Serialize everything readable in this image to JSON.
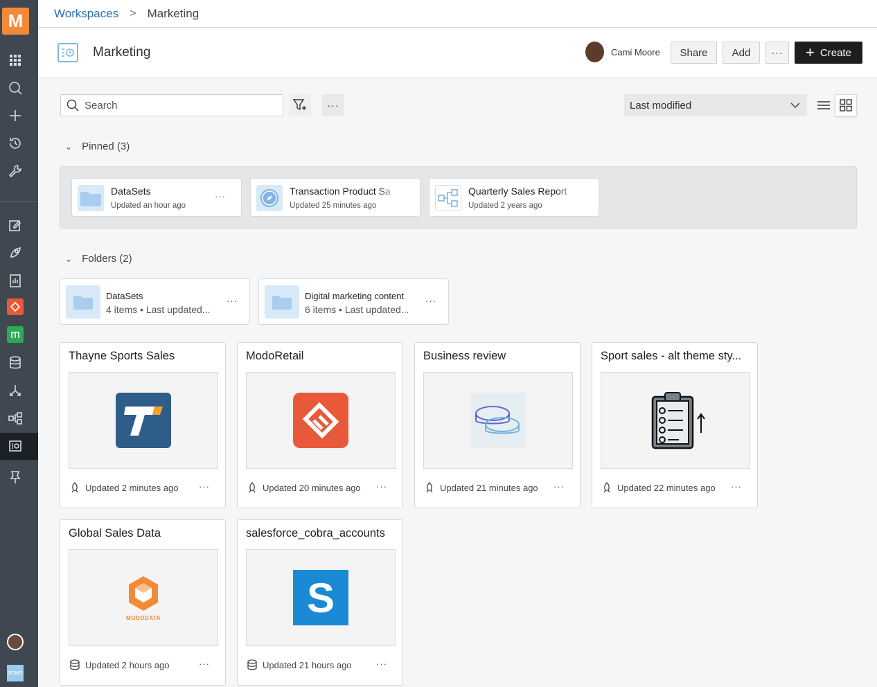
{
  "rail": {
    "logo": "M",
    "items": [
      "apps-icon",
      "search-icon",
      "plus-icon",
      "history-icon",
      "wrench-icon",
      "edit-sparkle-icon",
      "rocket-icon",
      "report-icon",
      "modo-retail-icon",
      "chart-app-icon",
      "database-icon",
      "dataflow-icon",
      "lineage-icon",
      "workspace-icon",
      "pin-icon"
    ],
    "footer_logo": "DOMO"
  },
  "breadcrumb": {
    "root": "Workspaces",
    "separator": ">",
    "current": "Marketing"
  },
  "header": {
    "title": "Marketing",
    "owner": "Cami Moore",
    "share_label": "Share",
    "add_label": "Add",
    "more_label": "···",
    "create_label": "Create",
    "create_icon": "+"
  },
  "toolbar": {
    "search_placeholder": "Search",
    "more_label": "···",
    "sort_value": "Last modified"
  },
  "pinned": {
    "heading": "Pinned (3)",
    "items": [
      {
        "name": "DataSets",
        "updated": "Updated an hour ago"
      },
      {
        "name": "Transaction Product Sa",
        "updated": "Updated 25 minutes ago"
      },
      {
        "name": "Quarterly Sales Report",
        "updated": "Updated 2 years ago"
      }
    ]
  },
  "folders": {
    "heading": "Folders (2)",
    "items": [
      {
        "name": "DataSets",
        "count": "4 items",
        "bullet": "•",
        "updated": "Last updated..."
      },
      {
        "name": "Digital marketing content",
        "count": "6 items",
        "bullet": "•",
        "updated": "Last updated..."
      }
    ]
  },
  "tiles": [
    {
      "title": "Thayne Sports Sales",
      "updated": "Updated 2 minutes ago",
      "type_icon": "app-icon",
      "thumb": "T"
    },
    {
      "title": "ModoRetail",
      "updated": "Updated 20 minutes ago",
      "type_icon": "app-icon"
    },
    {
      "title": "Business review",
      "updated": "Updated 21 minutes ago",
      "type_icon": "app-icon"
    },
    {
      "title": "Sport sales - alt theme sty...",
      "updated": "Updated 22 minutes ago",
      "type_icon": "app-icon"
    },
    {
      "title": "Global Sales Data",
      "updated": "Updated 2 hours ago",
      "type_icon": "dataset-icon",
      "thumb": "MODODATA"
    },
    {
      "title": "salesforce_cobra_accounts",
      "updated": "Updated 21 hours ago",
      "type_icon": "dataset-icon",
      "thumb": "S"
    }
  ],
  "menu_dots": "···",
  "colors": {
    "accent": "#f48a38",
    "rail": "#3f4851",
    "link": "#2c6fb0",
    "create_bg": "#1e1e1e"
  }
}
